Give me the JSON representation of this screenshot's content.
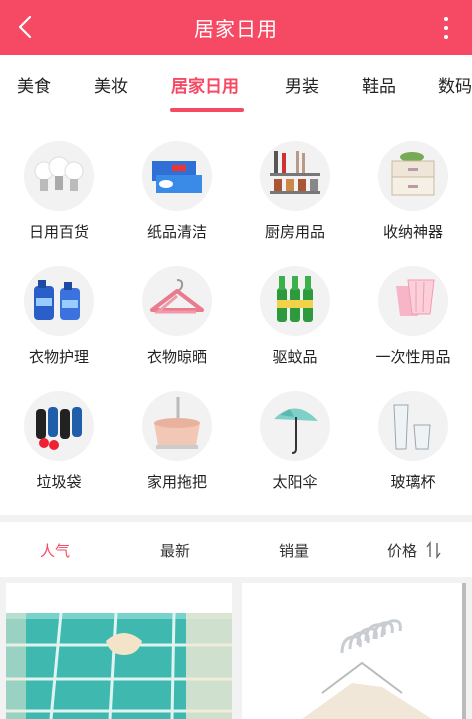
{
  "header": {
    "title": "居家日用"
  },
  "tabs": [
    {
      "label": "美食"
    },
    {
      "label": "美妆"
    },
    {
      "label": "居家日用",
      "active": true
    },
    {
      "label": "男装"
    },
    {
      "label": "鞋品"
    },
    {
      "label": "数码"
    }
  ],
  "categories": [
    {
      "label": "日用百货",
      "icon": "light-bulb-icon"
    },
    {
      "label": "纸品清洁",
      "icon": "tissue-box-icon"
    },
    {
      "label": "厨房用品",
      "icon": "kitchen-rack-icon"
    },
    {
      "label": "收纳神器",
      "icon": "storage-box-icon"
    },
    {
      "label": "衣物护理",
      "icon": "detergent-bottle-icon"
    },
    {
      "label": "衣物晾晒",
      "icon": "hanger-icon"
    },
    {
      "label": "驱蚊品",
      "icon": "repellent-bottle-icon"
    },
    {
      "label": "一次性用品",
      "icon": "paper-cup-icon"
    },
    {
      "label": "垃圾袋",
      "icon": "trash-bag-roll-icon"
    },
    {
      "label": "家用拖把",
      "icon": "mop-bucket-icon"
    },
    {
      "label": "太阳伞",
      "icon": "umbrella-icon"
    },
    {
      "label": "玻璃杯",
      "icon": "glass-cup-icon"
    }
  ],
  "sort": {
    "popular": "人气",
    "newest": "最新",
    "sales": "销量",
    "price": "价格"
  },
  "colors": {
    "accent": "#f64964",
    "tissue": "#3fb9b0",
    "bg": "#f2f2f2"
  }
}
